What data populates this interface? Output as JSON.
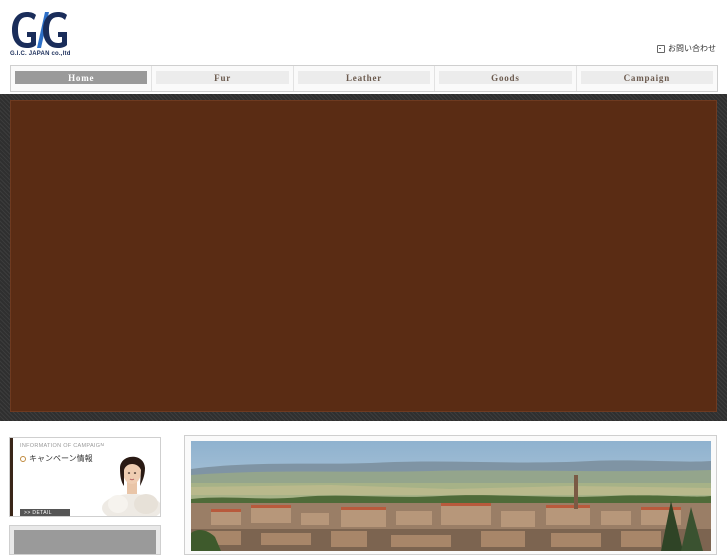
{
  "header": {
    "logo_text": "G.I.C. JAPAN co.,ltd",
    "contact_label": "お問い合わせ",
    "contact_icon": "mail-icon"
  },
  "nav": {
    "items": [
      {
        "label": "Home",
        "active": true
      },
      {
        "label": "Fur",
        "active": false
      },
      {
        "label": "Leather",
        "active": false
      },
      {
        "label": "Goods",
        "active": false
      },
      {
        "label": "Campaign",
        "active": false
      }
    ]
  },
  "hero": {
    "color": "#5a2c14"
  },
  "campaign_card": {
    "title": "INFORMATION OF CAMPAIGN",
    "heading": "キャンペーン情報",
    "detail_label": ">> DETAIL"
  },
  "colors": {
    "accent_brown": "#5a2c14",
    "nav_active": "#9a9a9a",
    "logo_blue": "#1a2d5a"
  }
}
